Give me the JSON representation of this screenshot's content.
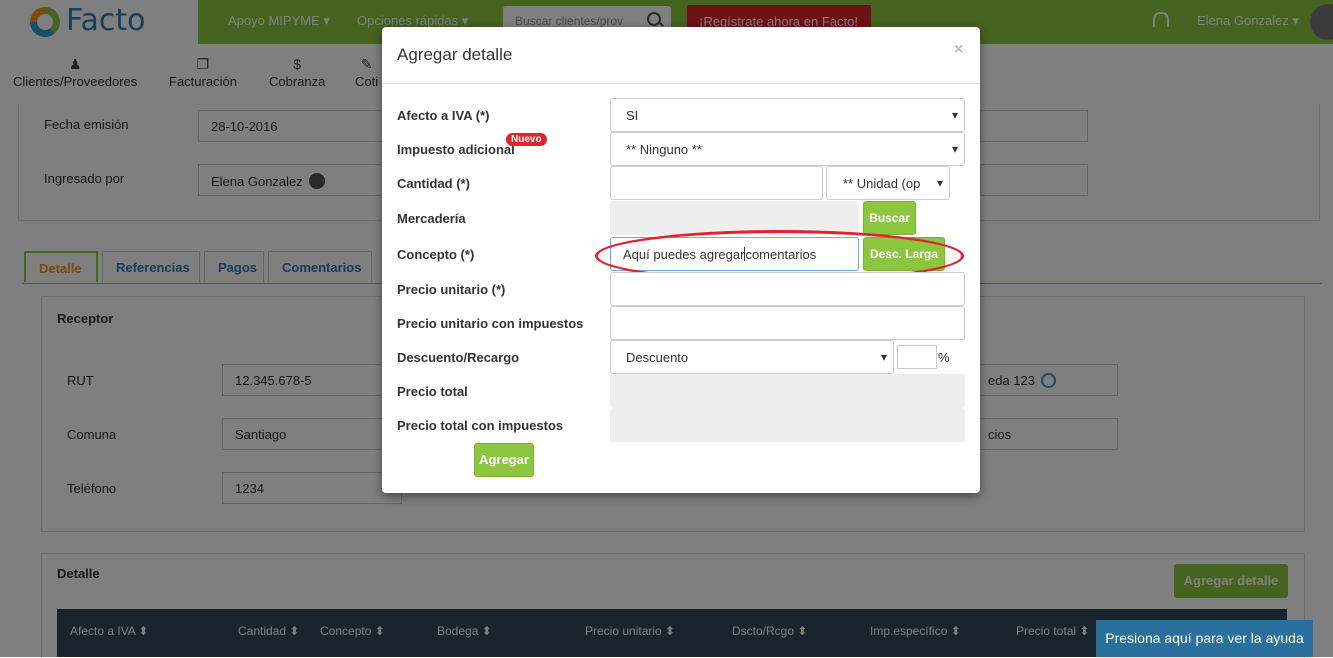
{
  "app": {
    "logo_text": "Facto",
    "top_links": [
      "Apoyo MIPYME ▾",
      "Opciones rápidas ▾"
    ],
    "search_placeholder": "Buscar clientes/prov",
    "register_button": "¡Regístrate ahora en Facto!",
    "user_name": "Elena Gonzalez ▾"
  },
  "menu": [
    {
      "label": "Clientes/Proveedores",
      "icon": "users-icon"
    },
    {
      "label": "Facturación",
      "icon": "documents-icon"
    },
    {
      "label": "Cobranza",
      "icon": "dollar-icon"
    },
    {
      "label": "Coti",
      "icon": "quote-icon"
    }
  ],
  "document": {
    "fecha_label": "Fecha emisión",
    "fecha_value": "28-10-2016",
    "ingresado_label": "Ingresado por",
    "ingresado_value": "Elena Gonzalez"
  },
  "tabs": [
    "Detalle",
    "Referencias",
    "Pagos",
    "Comentarios"
  ],
  "receptor": {
    "title": "Receptor",
    "rut_label": "RUT",
    "rut_value": "12.345.678-5",
    "comuna_label": "Comuna",
    "comuna_value": "Santiago",
    "telefono_label": "Teléfono",
    "telefono_value": "1234",
    "right_value_1": "eda 123",
    "right_value_2": "cios"
  },
  "detalle": {
    "title": "Detalle",
    "add_button": "Agregar detalle",
    "columns": [
      "Afecto a IVA ⬍",
      "Cantidad ⬍",
      "Concepto ⬍",
      "Bodega ⬍",
      "Precio unitario ⬍",
      "Dscto/Rcgo ⬍",
      "Imp.específico ⬍",
      "Precio total ⬍"
    ]
  },
  "modal": {
    "title": "Agregar detalle",
    "close": "×",
    "fields": {
      "afecto_label": "Afecto a IVA (*)",
      "afecto_value": "SI",
      "impuesto_label": "Impuesto adicional",
      "nuevo_badge": "Nuevo",
      "impuesto_value": "** Ninguno **",
      "cantidad_label": "Cantidad (*)",
      "cantidad_value": "",
      "unidad_value": "** Unidad (op",
      "mercaderia_label": "Mercadería",
      "buscar_button": "Buscar",
      "concepto_label": "Concepto (*)",
      "concepto_value_a": "Aquí puedes agregar",
      "concepto_value_b": "comentarios",
      "desc_larga_button": "Desc. Larga",
      "precio_unitario_label": "Precio unitario (*)",
      "precio_unitario_imp_label": "Precio unitario con impuestos",
      "descuento_label": "Descuento/Recargo",
      "descuento_value": "Descuento",
      "percent_symbol": "%",
      "precio_total_label": "Precio total",
      "precio_total_imp_label": "Precio total con impuestos"
    },
    "submit_button": "Agregar"
  },
  "help_button": "Presiona aquí para ver la ayuda",
  "colors": {
    "brand_green": "#8cc63f",
    "highlight_red": "#e0232d",
    "table_header": "#34495e"
  }
}
